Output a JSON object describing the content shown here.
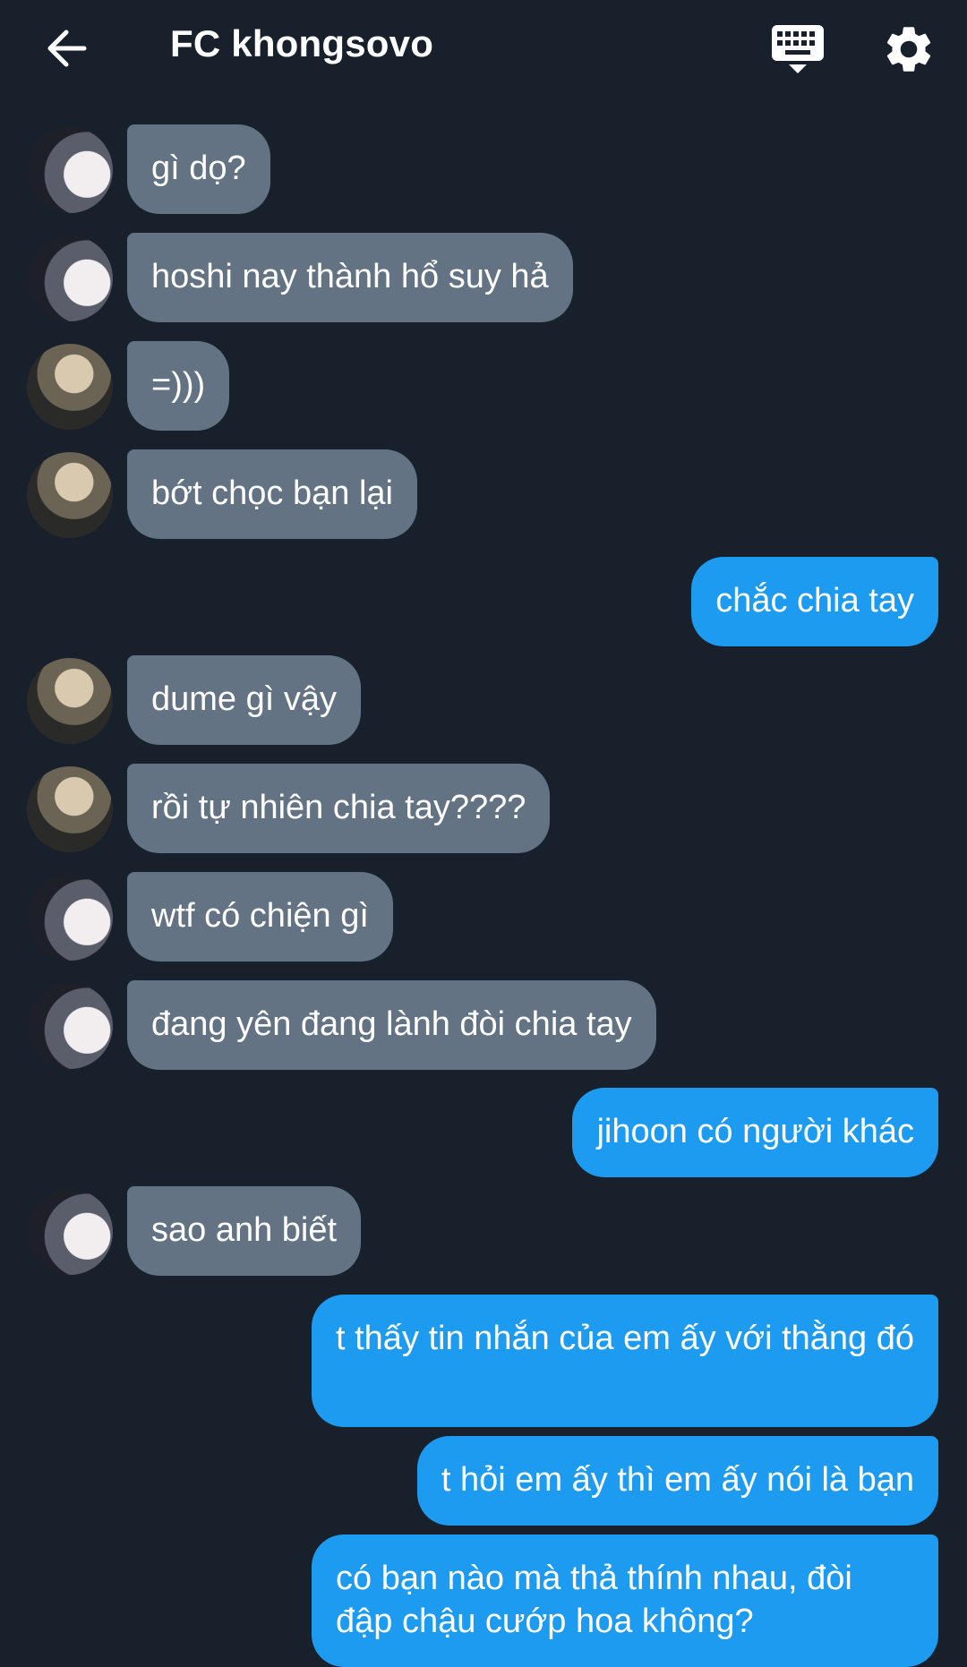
{
  "header": {
    "title": "FC khongsovo",
    "back_icon": "arrow-left-icon",
    "keyboard_icon": "keyboard-icon",
    "settings_icon": "gear-icon"
  },
  "colors": {
    "background": "#17202b",
    "incoming_bubble": "#637383",
    "outgoing_bubble": "#1d9bf0",
    "text": "#ffffff"
  },
  "messages": [
    {
      "direction": "incoming",
      "avatar": "a",
      "text": "gì dọ?"
    },
    {
      "direction": "incoming",
      "avatar": "a",
      "text": "hoshi nay thành hổ suy hả"
    },
    {
      "direction": "incoming",
      "avatar": "b",
      "text": "=)))"
    },
    {
      "direction": "incoming",
      "avatar": "b",
      "text": "bớt chọc bạn lại"
    },
    {
      "direction": "outgoing",
      "text": "chắc chia tay"
    },
    {
      "direction": "incoming",
      "avatar": "b",
      "text": "dume gì vậy"
    },
    {
      "direction": "incoming",
      "avatar": "b",
      "text": "rồi tự nhiên chia tay????"
    },
    {
      "direction": "incoming",
      "avatar": "a",
      "text": "wtf có chiện gì"
    },
    {
      "direction": "incoming",
      "avatar": "a",
      "text": "đang yên đang lành đòi chia tay"
    },
    {
      "direction": "outgoing",
      "text": "jihoon có người khác"
    },
    {
      "direction": "incoming",
      "avatar": "a",
      "text": "sao anh biết"
    },
    {
      "direction": "outgoing",
      "text": "t thấy tin nhắn của em ấy với thằng đó"
    },
    {
      "direction": "outgoing",
      "text": "t hỏi em ấy thì em ấy nói là bạn"
    },
    {
      "direction": "outgoing",
      "text": "có bạn nào mà thả thính nhau, đòi đập chậu cướp hoa không?"
    }
  ]
}
